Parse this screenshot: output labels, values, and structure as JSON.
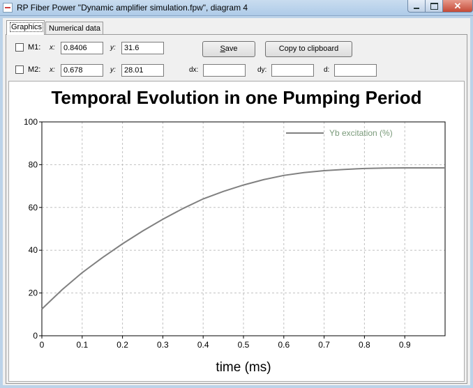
{
  "window": {
    "title": "RP Fiber Power \"Dynamic amplifier simulation.fpw\", diagram 4",
    "close_glyph": "✕"
  },
  "tabs": [
    {
      "label": "Graphics",
      "active": true
    },
    {
      "label": "Numerical data",
      "active": false
    }
  ],
  "markers": {
    "m1": {
      "label": "M1:",
      "x_label": "x:",
      "x_value": "0.8406",
      "y_label": "y:",
      "y_value": "31.6",
      "checked": false
    },
    "m2": {
      "label": "M2:",
      "x_label": "x:",
      "x_value": "0.678",
      "y_label": "y:",
      "y_value": "28.01",
      "checked": false
    }
  },
  "deltas": {
    "dx_label": "dx:",
    "dx_value": "",
    "dy_label": "dy:",
    "dy_value": "",
    "d_label": "d:",
    "d_value": ""
  },
  "buttons": {
    "save_prefix": "",
    "save_underline": "S",
    "save_rest": "ave",
    "copy_label": "Copy to clipboard"
  },
  "colors": {
    "curve": "#808080",
    "legend_text": "#7a9a7a",
    "grid": "#c0c0c0"
  },
  "chart_data": {
    "type": "line",
    "title": "Temporal Evolution in one Pumping Period",
    "xlabel": "time (ms)",
    "ylabel": "",
    "xlim": [
      0,
      1.0
    ],
    "ylim": [
      0,
      100
    ],
    "x_ticks": [
      0,
      0.1,
      0.2,
      0.3,
      0.4,
      0.5,
      0.6,
      0.7,
      0.8,
      0.9
    ],
    "x_tick_labels": [
      "0",
      "0.1",
      "0.2",
      "0.3",
      "0.4",
      "0.5",
      "0.6",
      "0.7",
      "0.8",
      "0.9"
    ],
    "y_ticks": [
      0,
      20,
      40,
      60,
      80,
      100
    ],
    "y_tick_labels": [
      "0",
      "20",
      "40",
      "60",
      "80",
      "100"
    ],
    "grid": true,
    "legend_position": "top-right",
    "series": [
      {
        "name": "Yb excitation (%)",
        "x": [
          0,
          0.05,
          0.1,
          0.15,
          0.2,
          0.25,
          0.3,
          0.35,
          0.4,
          0.45,
          0.5,
          0.55,
          0.6,
          0.65,
          0.7,
          0.75,
          0.8,
          0.85,
          0.9,
          0.95,
          1.0
        ],
        "y": [
          12.5,
          21.5,
          29.5,
          36.5,
          43.0,
          49.0,
          54.5,
          59.5,
          64.0,
          67.5,
          70.5,
          73.0,
          75.0,
          76.3,
          77.2,
          77.8,
          78.2,
          78.4,
          78.5,
          78.5,
          78.5
        ]
      }
    ]
  }
}
